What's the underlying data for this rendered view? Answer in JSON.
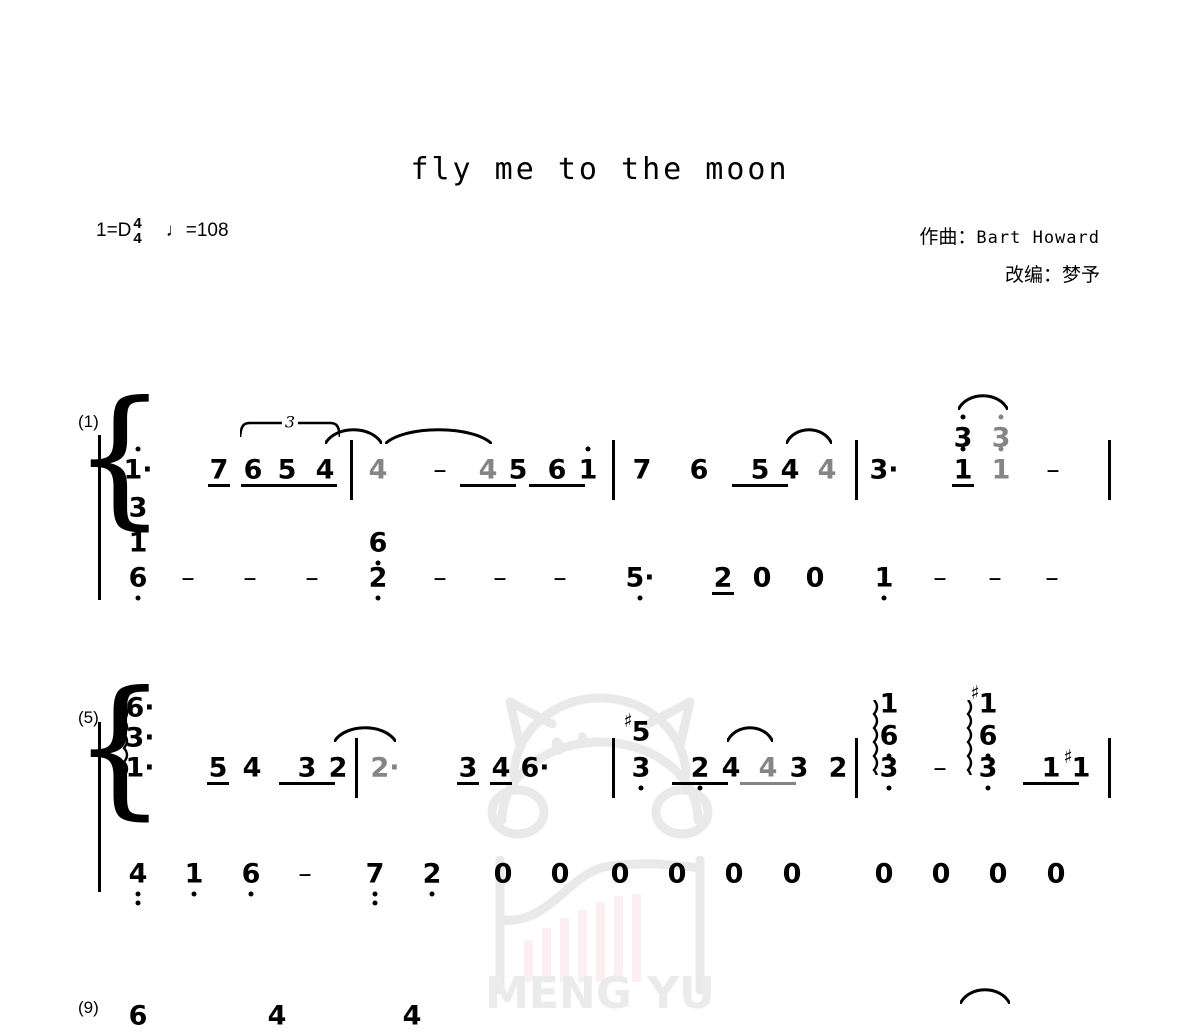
{
  "meta": {
    "title": "fly me to the moon",
    "key": "1=D",
    "time_numerator": "4",
    "time_denominator": "4",
    "tempo_note": "♩",
    "tempo_equals": "=108",
    "composer_label": "作曲：",
    "composer_name": "Bart Howard",
    "arranger_label": "改编：",
    "arranger_name": "梦予",
    "watermark_text": "MENG YU",
    "watermark_color": "#e8e8e8"
  },
  "systems": [
    {
      "number": "(1)",
      "measures": [
        {
          "index": 1,
          "treble": [
            {
              "text": "1",
              "dot_above": 1,
              "dotted": true
            },
            {
              "text": "7",
              "beams": 1
            },
            {
              "text": "6",
              "triplet": true
            },
            {
              "text": "5",
              "triplet": true
            },
            {
              "text": "4",
              "triplet": true
            }
          ],
          "bass": [
            {
              "stack": [
                "3",
                "1",
                "6"
              ],
              "low_dots": [
                0,
                0,
                1
              ]
            },
            {
              "text": "–"
            },
            {
              "text": "–"
            },
            {
              "text": "–"
            }
          ]
        },
        {
          "index": 2,
          "treble": [
            {
              "text": "4",
              "tied": true
            },
            {
              "text": "–"
            },
            {
              "text": "4",
              "beams": 1,
              "tied": true
            },
            {
              "text": "5",
              "beams": 1
            },
            {
              "text": "6",
              "beams": 1
            },
            {
              "text": "1",
              "beams": 1,
              "dot_above": 1
            }
          ],
          "bass": [
            {
              "stack": [
                "6",
                "2"
              ],
              "low_dots": [
                1,
                1
              ]
            },
            {
              "text": "–"
            },
            {
              "text": "–"
            },
            {
              "text": "–"
            }
          ]
        },
        {
          "index": 3,
          "treble": [
            {
              "text": "7"
            },
            {
              "text": "6"
            },
            {
              "text": "5",
              "beams": 1
            },
            {
              "text": "4",
              "beams": 1
            },
            {
              "text": "4",
              "tied": true
            }
          ],
          "bass": [
            {
              "text": "5",
              "low_dots": 1,
              "dotted": true
            },
            {
              "text": "2",
              "beams": 1
            },
            {
              "text": "0"
            },
            {
              "text": "0"
            }
          ]
        },
        {
          "index": 4,
          "treble": [
            {
              "text": "3",
              "dotted": true
            },
            {
              "stack": [
                "3",
                "1"
              ],
              "dot_above": 1,
              "beams": 1
            },
            {
              "stack": [
                "3",
                "1"
              ],
              "dot_above": 1,
              "tied": true
            },
            {
              "text": "–"
            }
          ],
          "bass": [
            {
              "text": "1",
              "low_dots": 1
            },
            {
              "text": "–"
            },
            {
              "text": "–"
            },
            {
              "text": "–"
            }
          ]
        }
      ]
    },
    {
      "number": "(5)",
      "measures": [
        {
          "index": 5,
          "treble": [
            {
              "stack": [
                "6",
                "3",
                "1"
              ],
              "dotted": true,
              "arpeggio": true
            },
            {
              "text": "5",
              "beams": 1
            },
            {
              "text": "4"
            },
            {
              "text": "3",
              "beams": 1
            },
            {
              "text": "2",
              "beams": 1
            }
          ],
          "bass": [
            {
              "text": "4",
              "low_dots": 2
            },
            {
              "text": "1",
              "low_dots": 1
            },
            {
              "text": "6",
              "low_dots": 1
            },
            {
              "text": "–"
            }
          ]
        },
        {
          "index": 6,
          "treble": [
            {
              "text": "2",
              "dotted": true,
              "tied": true
            },
            {
              "text": "3",
              "beams": 1
            },
            {
              "text": "4",
              "beams": 1
            },
            {
              "text": "6",
              "dotted": true
            }
          ],
          "bass": [
            {
              "text": "7",
              "low_dots": 2
            },
            {
              "text": "2",
              "low_dots": 1
            },
            {
              "text": "0"
            },
            {
              "text": "0"
            }
          ]
        },
        {
          "index": 7,
          "treble": [
            {
              "stack": [
                "5",
                "3"
              ],
              "sharp": true,
              "low_dots": [
                0,
                1
              ]
            },
            {
              "text": "2",
              "beams": 1,
              "low_dots": 1
            },
            {
              "text": "4",
              "beams": 1
            },
            {
              "text": "4",
              "beams": 1,
              "tied": true
            },
            {
              "text": "3",
              "beams": 1
            },
            {
              "text": "2"
            }
          ],
          "bass": [
            {
              "text": "0"
            },
            {
              "text": "0"
            },
            {
              "text": "0"
            },
            {
              "text": "0"
            }
          ]
        },
        {
          "index": 8,
          "treble": [
            {
              "stack": [
                "1",
                "6",
                "3"
              ],
              "dot_above": 1,
              "low_dots": [
                0,
                1,
                1
              ],
              "arpeggio": true
            },
            {
              "text": "–"
            },
            {
              "stack": [
                "1",
                "6",
                "3"
              ],
              "dot_above": 1,
              "low_dots": [
                0,
                1,
                1
              ],
              "arpeggio": true,
              "sharp": true
            },
            {
              "text": "1",
              "beams": 1
            },
            {
              "text": "1",
              "beams": 1,
              "sharp": true
            }
          ],
          "bass": [
            {
              "text": "0"
            },
            {
              "text": "0"
            },
            {
              "text": "0"
            },
            {
              "text": "0"
            }
          ]
        }
      ]
    },
    {
      "number": "(9)",
      "measures": []
    }
  ]
}
